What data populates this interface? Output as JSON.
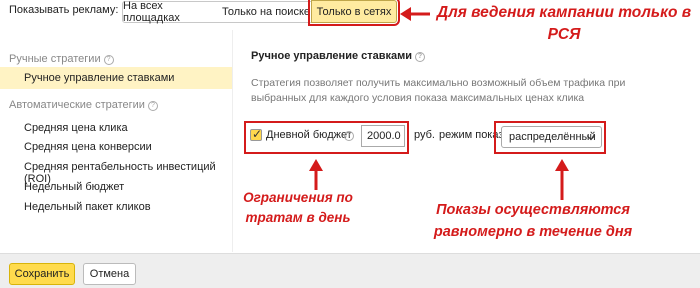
{
  "header": {
    "show_ads_label": "Показывать рекламу:",
    "tabs": [
      {
        "label": "На всех площадках",
        "active": false
      },
      {
        "label": "Только на поиске",
        "active": false
      },
      {
        "label": "Только в сетях",
        "active": true
      }
    ]
  },
  "annotations": {
    "top_note": "Для ведения кампании только в РСЯ",
    "left_note": "Ограничения по тратам в день",
    "right_note": "Показы осуществляются равномерно в течение дня",
    "color": "#d41b1b"
  },
  "sidebar": {
    "manual_header": "Ручные стратегии",
    "manual_items": [
      {
        "label": "Ручное управление ставками",
        "active": true
      }
    ],
    "auto_header": "Автоматические стратегии",
    "auto_items": [
      {
        "label": "Средняя цена клика"
      },
      {
        "label": "Средняя цена конверсии"
      },
      {
        "label": "Средняя рентабельность инвестиций (ROI)"
      },
      {
        "label": "Недельный бюджет"
      },
      {
        "label": "Недельный пакет кликов"
      }
    ]
  },
  "main": {
    "title": "Ручное управление ставками",
    "description": "Стратегия позволяет получить максимально возможный объем трафика при выбранных для каждого условия показа максимальных ценах клика",
    "daily_budget": {
      "checked": true,
      "label": "Дневной бюджет",
      "value": "2000.0",
      "currency": "руб.",
      "mode_label": "режим показа",
      "mode_value": "распределённый"
    }
  },
  "footer": {
    "save_label": "Сохранить",
    "cancel_label": "Отмена"
  },
  "colors": {
    "accent_yellow": "#ffdb4d",
    "active_tab_bg": "#ffeba0",
    "active_sidebar_bg": "#fff3c4"
  }
}
